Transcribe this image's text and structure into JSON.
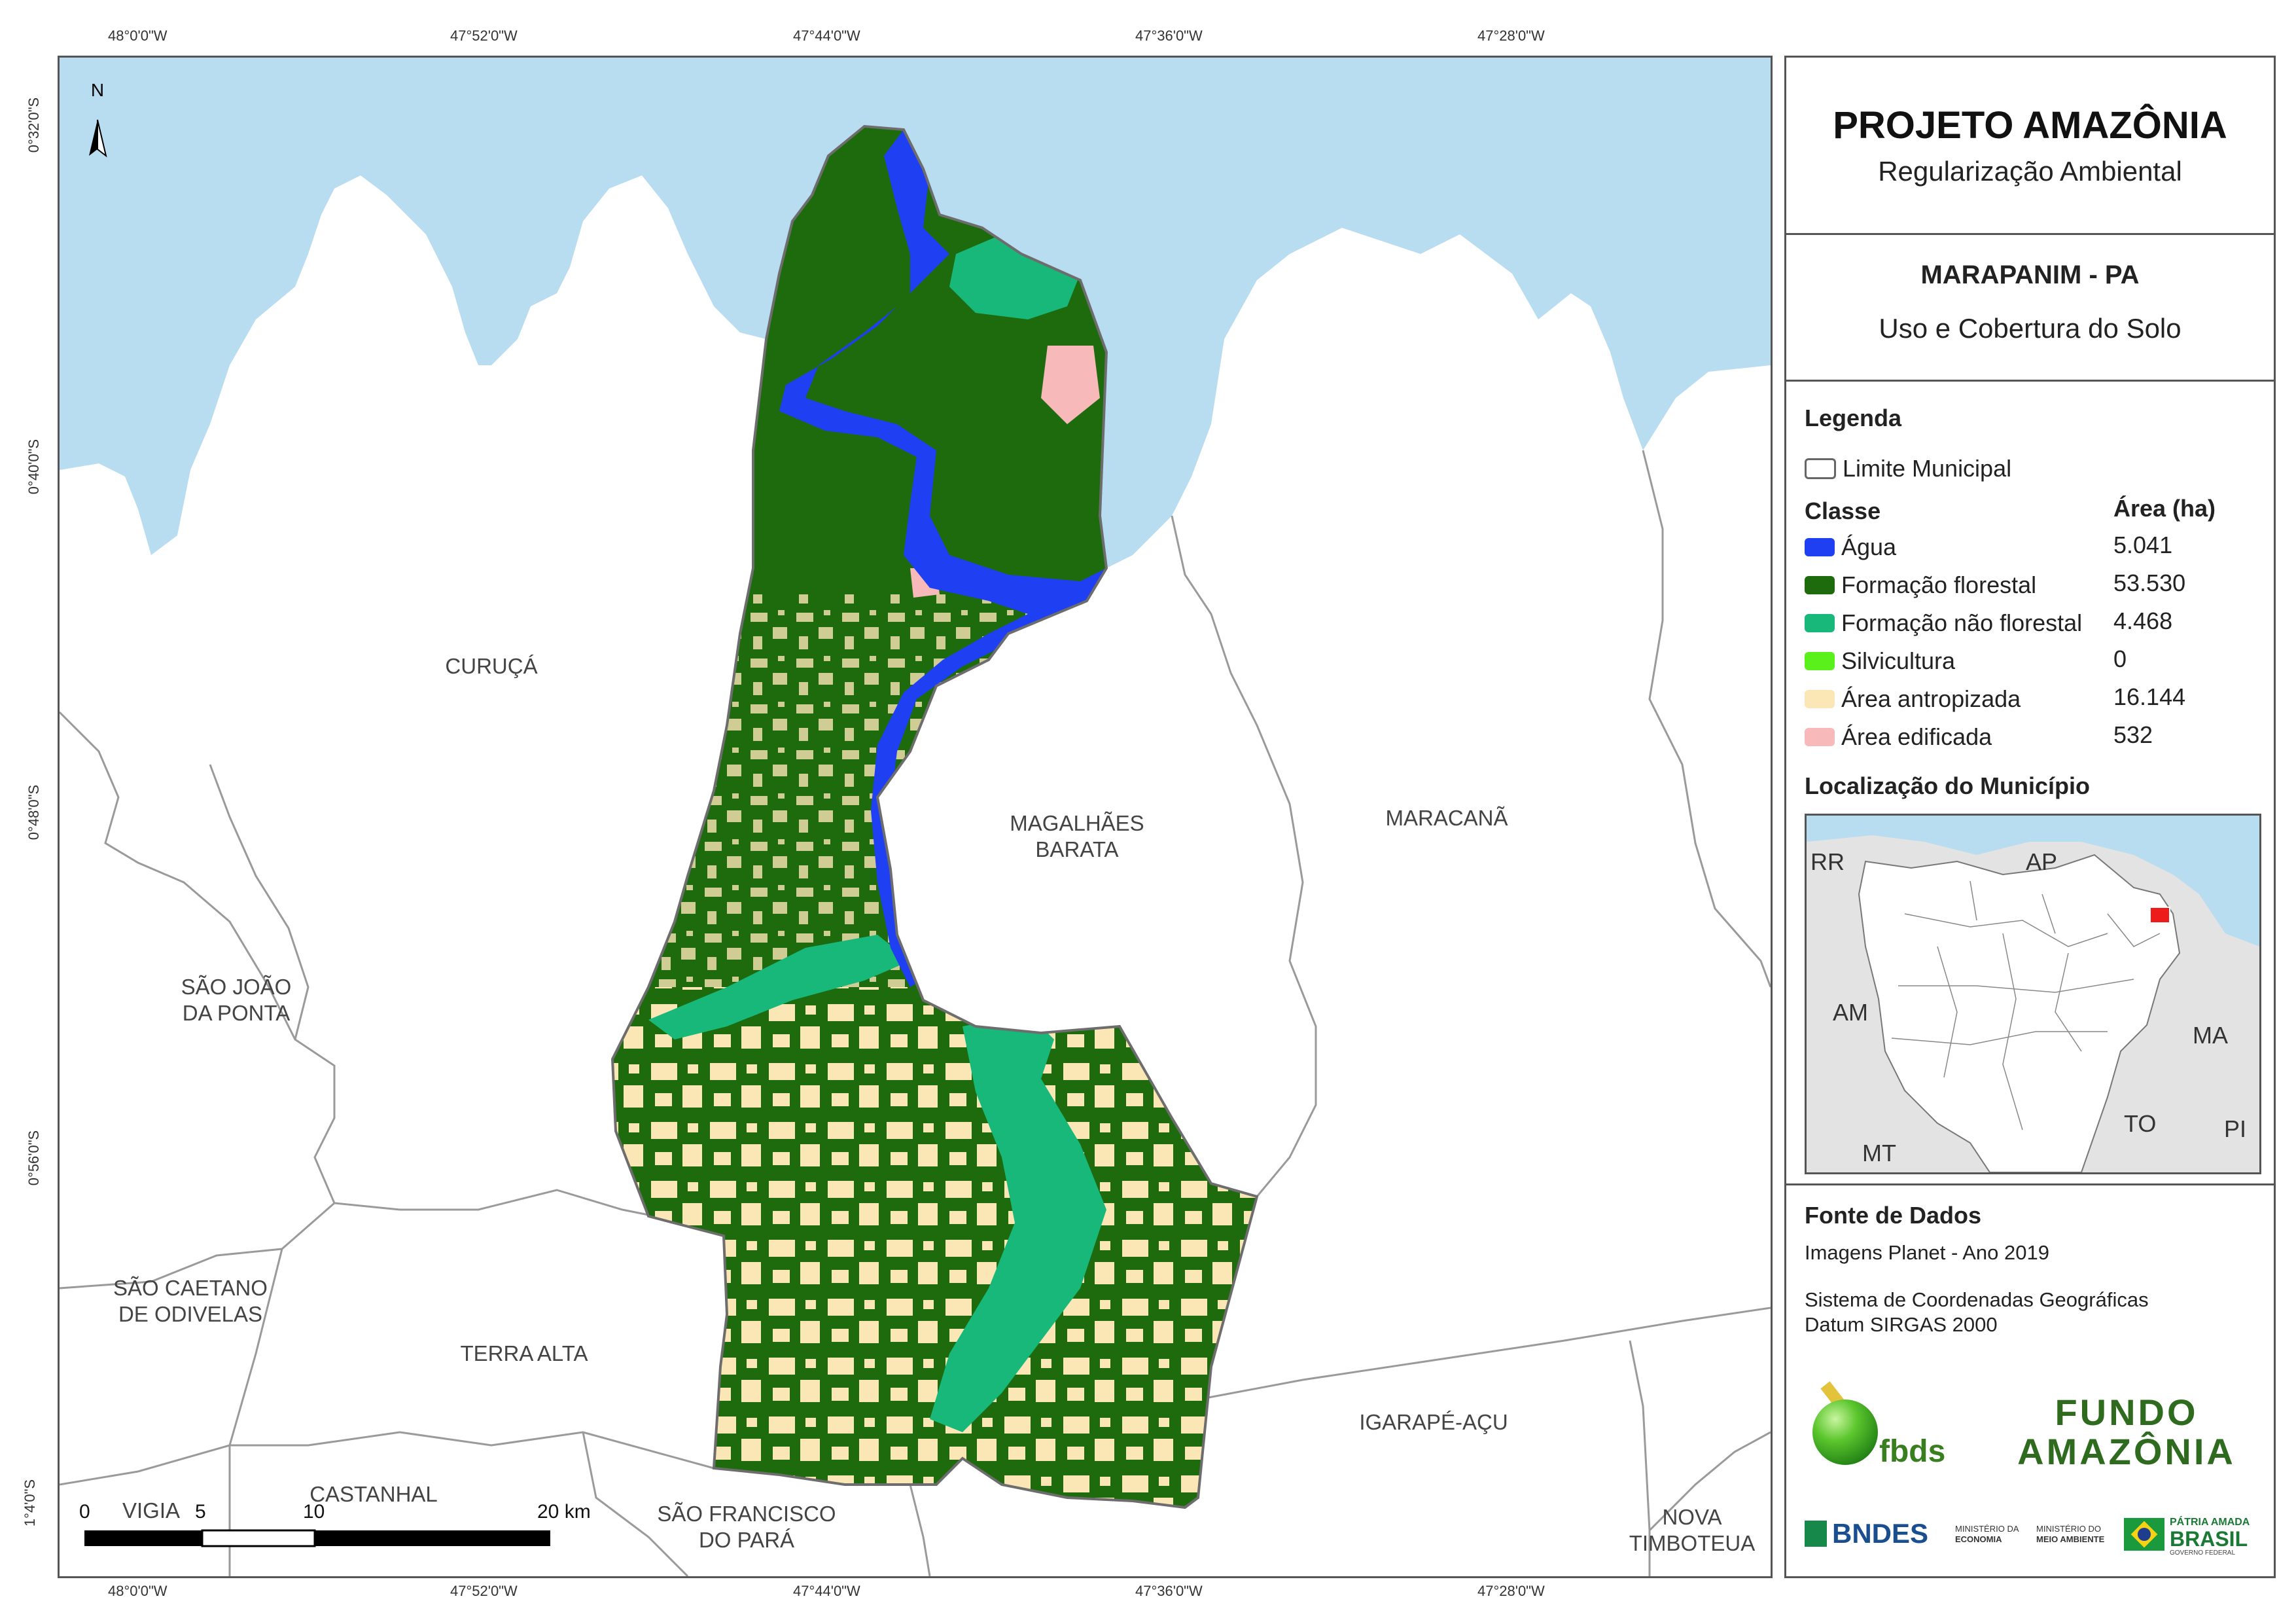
{
  "coords": {
    "top": [
      "48°0'0\"W",
      "47°52'0\"W",
      "47°44'0\"W",
      "47°36'0\"W",
      "47°28'0\"W"
    ],
    "bottom": [
      "48°0'0\"W",
      "47°52'0\"W",
      "47°44'0\"W",
      "47°36'0\"W",
      "47°28'0\"W"
    ],
    "left": [
      "0°32'0\"S",
      "0°40'0\"S",
      "0°48'0\"S",
      "0°56'0\"S",
      "1°4'0\"S"
    ]
  },
  "panel": {
    "title": "PROJETO AMAZÔNIA",
    "subtitle": "Regularização Ambiental",
    "municipality": "MARAPANIM - PA",
    "theme": "Uso e Cobertura do Solo",
    "legend_heading": "Legenda",
    "boundary_label": "Limite Municipal",
    "class_heading": "Classe",
    "area_heading": "Área (ha)",
    "classes": [
      {
        "label": "Água",
        "area": "5.041",
        "color": "#1f3ff2"
      },
      {
        "label": "Formação florestal",
        "area": "53.530",
        "color": "#1e6b0e"
      },
      {
        "label": "Formação não florestal",
        "area": "4.468",
        "color": "#17b87a"
      },
      {
        "label": "Silvicultura",
        "area": "0",
        "color": "#5af01b"
      },
      {
        "label": "Área antropizada",
        "area": "16.144",
        "color": "#fbe6b6"
      },
      {
        "label": "Área edificada",
        "area": "532",
        "color": "#f7b9b9"
      }
    ],
    "location_heading": "Localização do Município",
    "inset_states": [
      "RR",
      "AP",
      "AM",
      "MA",
      "TO",
      "PI",
      "MT"
    ],
    "sources_heading": "Fonte de Dados",
    "source_1": "Imagens Planet - Ano 2019",
    "source_2": "Sistema de Coordenadas Geográficas",
    "source_3": "Datum SIRGAS 2000",
    "logos": {
      "fbds": "fbds",
      "fundo_1": "FUNDO",
      "fundo_2": "AMAZÔNIA",
      "bndes": "BNDES",
      "min_economia_1": "MINISTÉRIO DA",
      "min_economia_2": "ECONOMIA",
      "min_ambiente_1": "MINISTÉRIO DO",
      "min_ambiente_2": "MEIO AMBIENTE",
      "patria_1": "PÁTRIA AMADA",
      "patria_2": "BRASIL",
      "patria_3": "GOVERNO FEDERAL"
    }
  },
  "map_labels": {
    "curuca": "CURUÇÁ",
    "magalhaes_1": "MAGALHÃES",
    "magalhaes_2": "BARATA",
    "maracana": "MARACANÃ",
    "sao_joao_1": "SÃO JOÃO",
    "sao_joao_2": "DA PONTA",
    "sao_caetano_1": "SÃO CAETANO",
    "sao_caetano_2": "DE ODIVELAS",
    "terra_alta": "TERRA ALTA",
    "igarape": "IGARAPÉ-AÇU",
    "vigia": "VIGIA",
    "castanhal": "CASTANHAL",
    "sao_francisco_1": "SÃO FRANCISCO",
    "sao_francisco_2": "DO PARÁ",
    "nova_1": "NOVA",
    "nova_2": "TIMBOTEUA",
    "north": "N"
  },
  "scale": {
    "ticks": [
      "0",
      "5",
      "10",
      "20 km"
    ]
  }
}
